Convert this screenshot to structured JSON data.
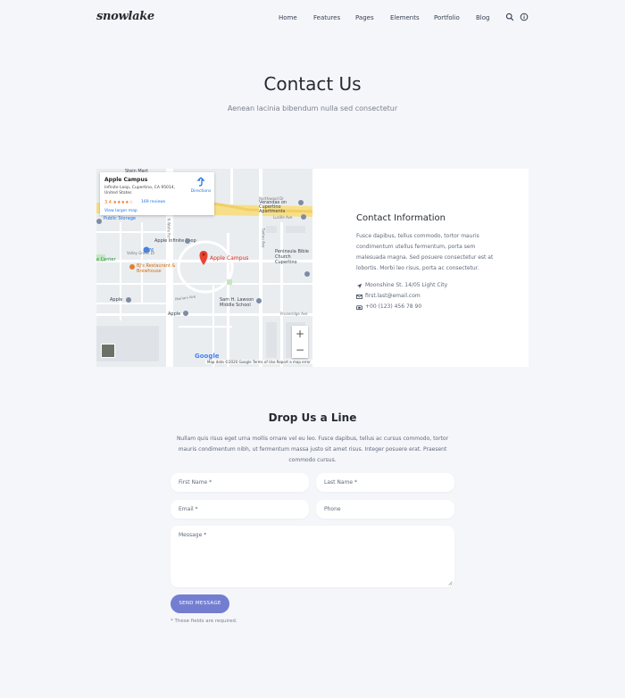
{
  "header": {
    "logo": "snowlake",
    "nav": [
      "Home",
      "Features",
      "Pages",
      "Elements",
      "Portfolio",
      "Blog"
    ],
    "icons": [
      "search-icon",
      "info-icon"
    ]
  },
  "hero": {
    "title": "Contact Us",
    "subtitle": "Aenean lacinia bibendum nulla sed consectetur"
  },
  "map": {
    "place_name": "Apple Campus",
    "place_address": "Infinite Loop, Cupertino, CA 95014, United States",
    "rating": "3.4 ★★★★☆",
    "reviews": "169 reviews",
    "directions": "Directions",
    "view_larger": "View larger map",
    "labels": {
      "stein_mart": "Stein Mart",
      "public_storage": "Public Storage",
      "apple_infinite_loop": "Apple Infinite Loop",
      "apple_campus": "Apple Campus",
      "center": "e Center",
      "bjs": "BJ's Restaurant & Brewhouse",
      "apple_1": "Apple",
      "apple_2": "Apple",
      "peninsula": "Peninsula Bible Church Cupertino",
      "sam_lawson": "Sam H. Lawson Middle School",
      "verandas": "Verandas on Cupertino Apartments",
      "num_76": "76",
      "northwood": "Northwood Dr",
      "mariani": "Mariani Ave",
      "lucille": "Lucille Ave",
      "valley_green": "Valley Green Dr",
      "pruneridge": "Pruneridge Ave",
      "tantau": "Tantau Ave",
      "wolfe": "N Wolfe Rd"
    },
    "google": "Google",
    "footer": "Map data ©2020 Google   Terms of Use   Report a map error",
    "zoom_in": "+",
    "zoom_out": "−"
  },
  "contact": {
    "title": "Contact Information",
    "text": "Fusce dapibus, tellus commodo, tortor mauris condimentum utellus fermentum, porta sem malesuada magna. Sed posuere consectetur est at lobortis. Morbi leo risus, porta ac consectetur.",
    "address": "Moonshine St. 14/05 Light City",
    "email": "first.last@email.com",
    "phone": "+00 (123) 456 78 90"
  },
  "form": {
    "title": "Drop Us a Line",
    "description": "Nullam quis risus eget urna mollis ornare vel eu leo. Fusce dapibus, tellus ac cursus commodo, tortor mauris condimentum nibh, ut fermentum massa justo sit amet risus. Integer posuere erat. Praesent commodo cursus.",
    "first_name": "First Name *",
    "last_name": "Last Name *",
    "email": "Email *",
    "phone": "Phone",
    "message": "Message *",
    "submit": "SEND MESSAGE",
    "note": "* These fields are required."
  }
}
